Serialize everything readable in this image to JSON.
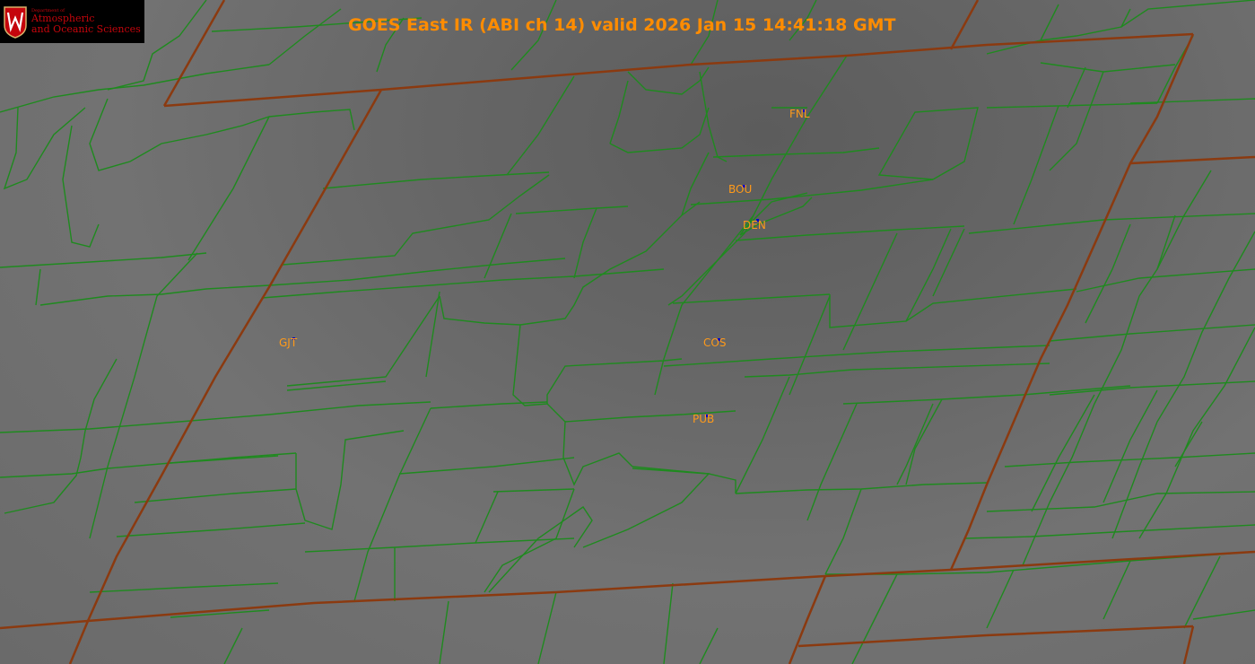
{
  "title": "GOES East IR (ABI ch 14) valid 2026 Jan 15 14:41:18 GMT",
  "logo": {
    "department": "Department of",
    "line1": "Atmospheric",
    "line2": "and Oceanic Sciences"
  },
  "stations": [
    {
      "id": "fnl",
      "label": "FNL"
    },
    {
      "id": "bou",
      "label": "BOU"
    },
    {
      "id": "den",
      "label": "DEN"
    },
    {
      "id": "gjt",
      "label": "GJT"
    },
    {
      "id": "cos",
      "label": "COS"
    },
    {
      "id": "pub",
      "label": "PUB"
    }
  ],
  "colors": {
    "county_lines": "#1f8a1f",
    "state_border": "#8b3a10",
    "title_text": "#ff8c00",
    "station_label": "#ff9a1a",
    "station_marker": "#0000cc"
  }
}
